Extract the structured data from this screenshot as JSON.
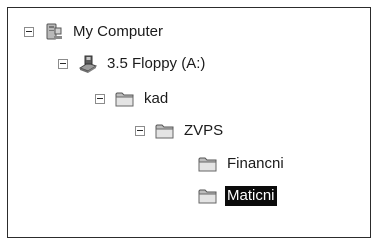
{
  "tree": {
    "nodes": [
      {
        "label": "My Computer",
        "icon": "computer-icon",
        "expanded": true
      },
      {
        "label": "3.5 Floppy (A:)",
        "icon": "floppy-drive-icon",
        "expanded": true
      },
      {
        "label": "kad",
        "icon": "folder-icon",
        "expanded": true
      },
      {
        "label": "ZVPS",
        "icon": "folder-icon",
        "expanded": true
      },
      {
        "label": "Financni",
        "icon": "folder-icon"
      },
      {
        "label": "Maticni",
        "icon": "folder-icon",
        "selected": true
      }
    ]
  },
  "colors": {
    "selection_bg": "#0b0b0b",
    "selection_text": "#ffffff",
    "border": "#2c2c2c"
  }
}
